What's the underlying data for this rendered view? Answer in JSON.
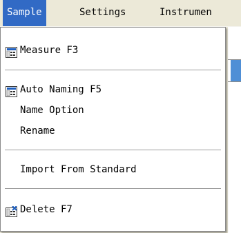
{
  "menubar": {
    "items": [
      "Sample",
      "Settings",
      "Instrumen"
    ]
  },
  "dropdown": {
    "items": [
      {
        "label": "Measure F3",
        "icon": "measure-icon"
      },
      {
        "label": "Auto Naming F5",
        "icon": "auto-naming-icon"
      },
      {
        "label": "Name Option",
        "icon": ""
      },
      {
        "label": "Rename",
        "icon": ""
      },
      {
        "label": "Import From Standard",
        "icon": ""
      },
      {
        "label": "Delete F7",
        "icon": "delete-icon"
      }
    ]
  },
  "colors": {
    "highlight": "#316ac5",
    "menu_bg": "#ece9d8",
    "dropdown_bg": "#ffffff"
  }
}
